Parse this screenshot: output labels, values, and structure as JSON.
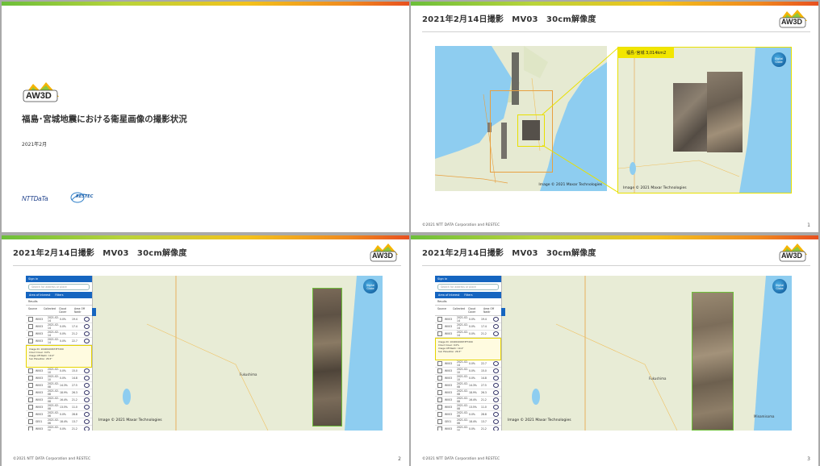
{
  "slide1": {
    "logo_text": "AW3D",
    "title": "福島･宮城地震における衛星画像の撮影状況",
    "date": "2021年2月",
    "nttdata_logo": "NTTDaTa",
    "restec_logo": "RESTEC"
  },
  "slide2": {
    "title": "2021年2月14日撮影　MV03　30cm解像度",
    "logo_text": "AW3D",
    "area_label": "福島･宮城 3,014km2",
    "credit_left": "Image © 2021 Maxar Technologies",
    "credit_right": "Image © 2021 Maxar Technologies",
    "globe_label": "Digital Globe",
    "footer": "©2021 NTT DATA Corporation and RESTEC",
    "page": "1"
  },
  "slide3": {
    "title": "2021年2月14日撮影　MV03　30cm解像度",
    "logo_text": "AW3D",
    "credit": "Image © 2021 Maxar Technologies",
    "globe_label": "Digital Globe",
    "footer": "©2021 NTT DATA Corporation and RESTEC",
    "page": "2",
    "city_label": "Fukushima",
    "panel": {
      "signin": "Sign in",
      "search_placeholder": "Search for address or place",
      "tab_selected": "Area of Interest",
      "tab_filters": "Filters",
      "results": "Results",
      "columns": [
        "Source",
        "Collected",
        "Cloud Cover",
        "Area Off Nadir"
      ],
      "detail_lines": [
        "Image ID: 10400100673F7200",
        "Cloud Cover: 0.0%",
        "Image Off Nadir: 19.4°",
        "Sun Elevation: 26.5°"
      ]
    }
  },
  "slide4": {
    "title": "2021年2月14日撮影　MV03　30cm解像度",
    "logo_text": "AW3D",
    "credit": "Image © 2021 Maxar Technologies",
    "globe_label": "Digital Globe",
    "footer": "©2021 NTT DATA Corporation and RESTEC",
    "page": "3",
    "city_label": "Fukushima",
    "city_label2": "Minamisoma",
    "panel": {
      "signin": "Sign in",
      "search_placeholder": "Search for address or place",
      "tab_selected": "Area of Interest",
      "tab_filters": "Filters",
      "results": "Results",
      "columns": [
        "Source",
        "Collected",
        "Cloud Cover",
        "Area Off Nadir"
      ],
      "detail_lines": [
        "Image ID: 10400100673F7200",
        "Cloud Cover: 0.0%",
        "Image Off Nadir: 19.4°",
        "Sun Elevation: 26.5°"
      ]
    }
  },
  "result_rows": [
    {
      "src": "WV03",
      "date": "2021-02-14",
      "cc": "0.0%",
      "on": "19.4"
    },
    {
      "src": "WV03",
      "date": "2021-02-14",
      "cc": "0.0%",
      "on": "17.4"
    },
    {
      "src": "WV03",
      "date": "2021-02-14",
      "cc": "0.0%",
      "on": "21.2"
    },
    {
      "src": "WV03",
      "date": "2021-02-14",
      "cc": "0.0%",
      "on": "22.7"
    },
    {
      "src": "WV03",
      "date": "2021-02-10",
      "cc": "0.0%",
      "on": "15.0"
    },
    {
      "src": "WV03",
      "date": "2021-02-10",
      "cc": "0.0%",
      "on": "14.8"
    },
    {
      "src": "WV03",
      "date": "2021-02-08",
      "cc": "14.3%",
      "on": "27.5"
    },
    {
      "src": "WV03",
      "date": "2021-02-08",
      "cc": "18.9%",
      "on": "26.3"
    },
    {
      "src": "WV03",
      "date": "2021-02-08",
      "cc": "16.4%",
      "on": "21.2"
    },
    {
      "src": "WV03",
      "date": "2021-02-08",
      "cc": "13.5%",
      "on": "11.0"
    },
    {
      "src": "WV03",
      "date": "2021-02-06",
      "cc": "0.0%",
      "on": "28.8"
    },
    {
      "src": "GE01",
      "date": "2021-02-06",
      "cc": "18.4%",
      "on": "13.7"
    },
    {
      "src": "WV03",
      "date": "2021-02-06",
      "cc": "0.0%",
      "on": "21.2"
    },
    {
      "src": "WV03",
      "date": "2021-02-06",
      "cc": "0.0%",
      "on": "17.3"
    },
    {
      "src": "WV03",
      "date": "2021-02-06",
      "cc": "0.0%",
      "on": "16.7"
    }
  ],
  "colors": {
    "panel_blue": "#1565c0",
    "highlight_yellow": "#f2e600",
    "water": "#8ecdf0"
  }
}
